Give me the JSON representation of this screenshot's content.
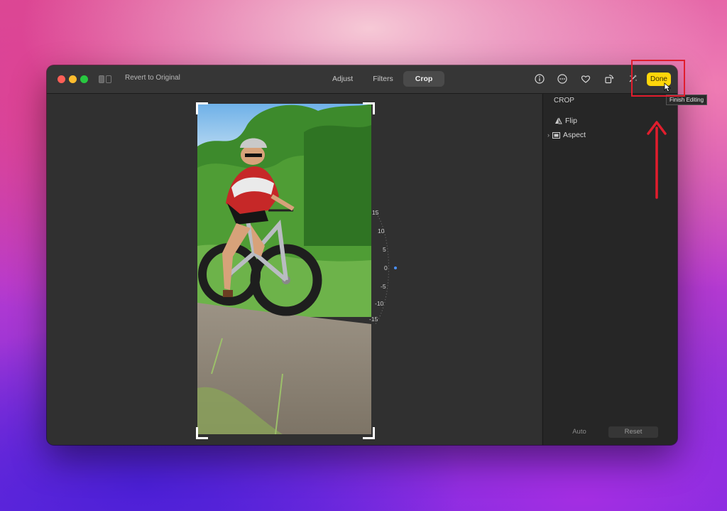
{
  "toolbar": {
    "revert_label": "Revert to Original",
    "tabs": [
      {
        "label": "Adjust"
      },
      {
        "label": "Filters"
      },
      {
        "label": "Crop",
        "active": true
      }
    ],
    "icons": [
      "info-icon",
      "more-icon",
      "heart-icon",
      "rotate-icon",
      "magic-wand-icon"
    ],
    "done_label": "Done",
    "done_color": "#ffd60a"
  },
  "tooltip": {
    "text": "Finish Editing"
  },
  "dial": {
    "labels": [
      "15",
      "10",
      "5",
      "0",
      "-5",
      "-10",
      "-15"
    ]
  },
  "sidebar": {
    "title": "CROP",
    "items": [
      {
        "label": "Flip",
        "icon": "flip-icon"
      },
      {
        "label": "Aspect",
        "icon": "aspect-icon"
      }
    ],
    "auto_label": "Auto",
    "reset_label": "Reset"
  },
  "annotation": {
    "color": "#e11d2d"
  }
}
